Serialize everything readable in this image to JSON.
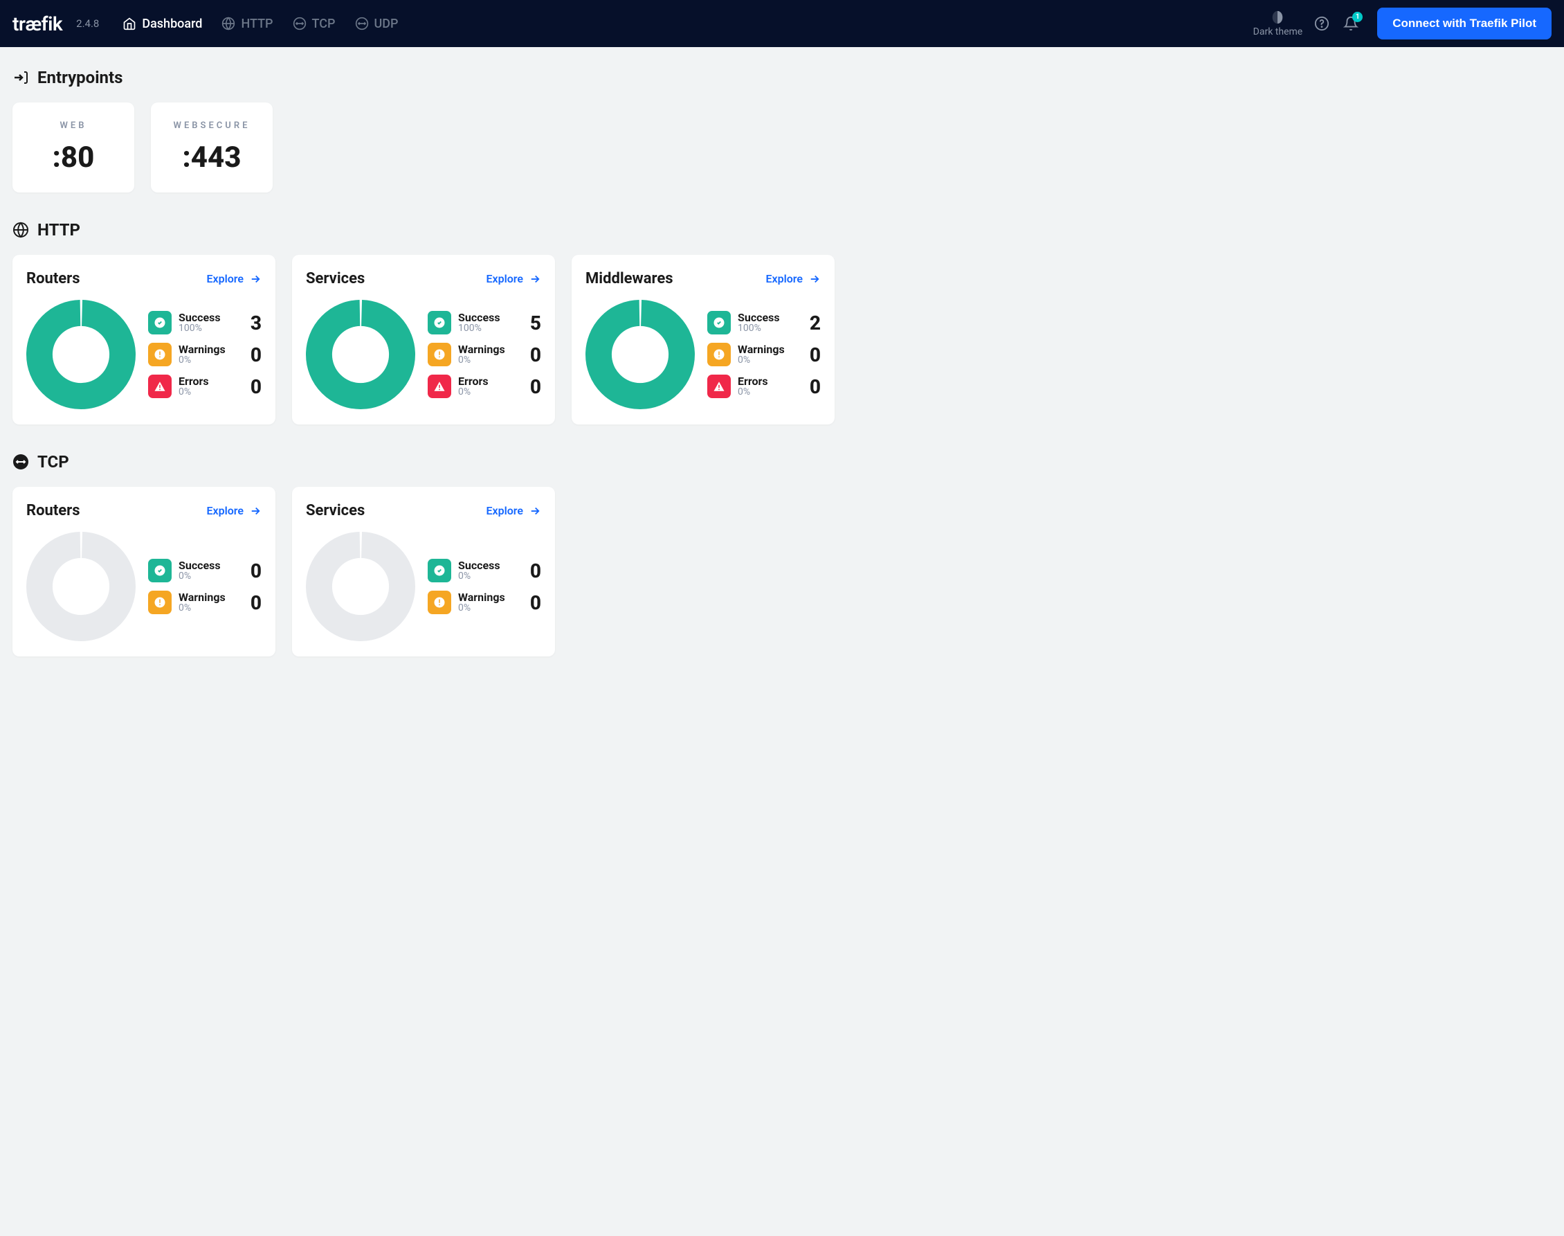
{
  "app": {
    "logo_text": "træfik",
    "version": "2.4.8"
  },
  "nav": {
    "dashboard": "Dashboard",
    "http": "HTTP",
    "tcp": "TCP",
    "udp": "UDP"
  },
  "topbar": {
    "theme_label": "Dark theme",
    "bell_badge": "1",
    "pilot_button": "Connect with Traefik Pilot"
  },
  "sections": {
    "entrypoints": "Entrypoints",
    "http": "HTTP",
    "tcp": "TCP"
  },
  "entrypoints": [
    {
      "name": "WEB",
      "port": ":80"
    },
    {
      "name": "WEBSECURE",
      "port": ":443"
    }
  ],
  "explore_label": "Explore",
  "metric_labels": {
    "success": "Success",
    "warnings": "Warnings",
    "errors": "Errors"
  },
  "http_cards": {
    "routers": {
      "title": "Routers",
      "success_pct": "100%",
      "success_count": "3",
      "warning_pct": "0%",
      "warning_count": "0",
      "error_pct": "0%",
      "error_count": "0"
    },
    "services": {
      "title": "Services",
      "success_pct": "100%",
      "success_count": "5",
      "warning_pct": "0%",
      "warning_count": "0",
      "error_pct": "0%",
      "error_count": "0"
    },
    "middlewares": {
      "title": "Middlewares",
      "success_pct": "100%",
      "success_count": "2",
      "warning_pct": "0%",
      "warning_count": "0",
      "error_pct": "0%",
      "error_count": "0"
    }
  },
  "tcp_cards": {
    "routers": {
      "title": "Routers",
      "success_pct": "0%",
      "success_count": "0",
      "warning_pct": "0%",
      "warning_count": "0"
    },
    "services": {
      "title": "Services",
      "success_pct": "0%",
      "success_count": "0",
      "warning_pct": "0%",
      "warning_count": "0"
    }
  },
  "chart_data": [
    {
      "type": "pie",
      "title": "HTTP Routers",
      "categories": [
        "Success",
        "Warnings",
        "Errors"
      ],
      "values": [
        3,
        0,
        0
      ]
    },
    {
      "type": "pie",
      "title": "HTTP Services",
      "categories": [
        "Success",
        "Warnings",
        "Errors"
      ],
      "values": [
        5,
        0,
        0
      ]
    },
    {
      "type": "pie",
      "title": "HTTP Middlewares",
      "categories": [
        "Success",
        "Warnings",
        "Errors"
      ],
      "values": [
        2,
        0,
        0
      ]
    },
    {
      "type": "pie",
      "title": "TCP Routers",
      "categories": [
        "Success",
        "Warnings",
        "Errors"
      ],
      "values": [
        0,
        0,
        0
      ]
    },
    {
      "type": "pie",
      "title": "TCP Services",
      "categories": [
        "Success",
        "Warnings",
        "Errors"
      ],
      "values": [
        0,
        0,
        0
      ]
    }
  ],
  "colors": {
    "success": "#1eb696",
    "warning": "#f5a623",
    "error": "#f02849",
    "accent": "#1668ff",
    "topbar": "#06102a",
    "empty_donut": "#e8eaed"
  }
}
